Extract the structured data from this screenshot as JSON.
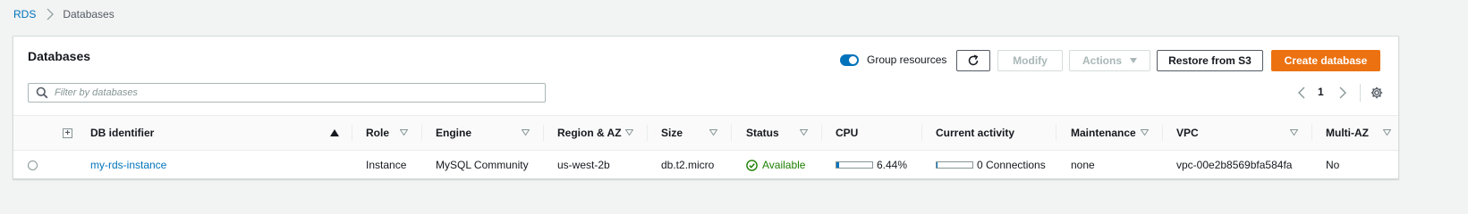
{
  "breadcrumb": {
    "root": "RDS",
    "current": "Databases"
  },
  "panel": {
    "title": "Databases",
    "group_toggle_label": "Group resources",
    "group_toggle_on": true,
    "buttons": {
      "modify": "Modify",
      "actions": "Actions",
      "restore": "Restore from S3",
      "create": "Create database"
    },
    "filter_placeholder": "Filter by databases",
    "pagination": {
      "current_page": "1"
    }
  },
  "table": {
    "columns": [
      "DB identifier",
      "Role",
      "Engine",
      "Region & AZ",
      "Size",
      "Status",
      "CPU",
      "Current activity",
      "Maintenance",
      "VPC",
      "Multi-AZ"
    ],
    "rows": [
      {
        "db_identifier": "my-rds-instance",
        "role": "Instance",
        "engine": "MySQL Community",
        "region_az": "us-west-2b",
        "size": "db.t2.micro",
        "status": "Available",
        "cpu": "6.44%",
        "cpu_value": 0.0644,
        "activity": "0 Connections",
        "activity_value": 0,
        "maintenance": "none",
        "vpc": "vpc-00e2b8569bfa584fa",
        "multi_az": "No"
      }
    ]
  },
  "colors": {
    "link": "#0073bb",
    "primary": "#ec7211",
    "success": "#1d8102"
  }
}
